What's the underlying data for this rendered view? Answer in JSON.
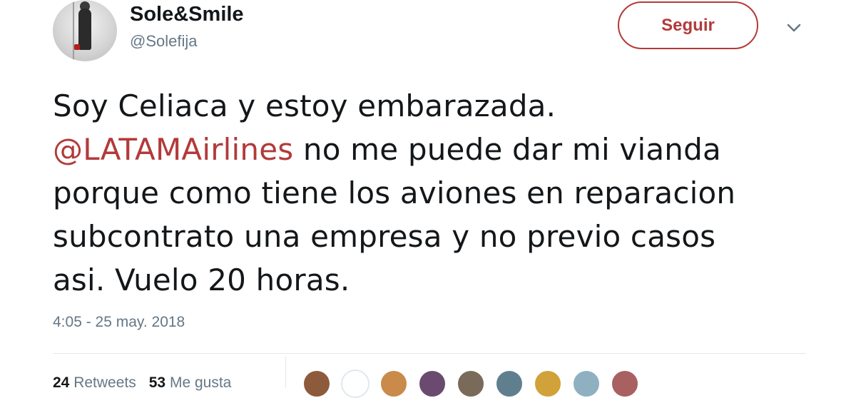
{
  "user": {
    "display_name": "Sole&Smile",
    "handle": "@Solefija",
    "avatar_icon": "profile-photo-icon"
  },
  "follow_button": {
    "label": "Seguir"
  },
  "menu_caret": {
    "icon": "chevron-down-icon"
  },
  "tweet": {
    "line1": "Soy Celiaca y estoy embarazada.",
    "mention": "@LATAMAirlines",
    "line2_rest": " no me puede dar mi vianda",
    "line3": "porque como tiene los aviones en reparacion",
    "line4": "subcontrato una empresa y no previo casos",
    "line5": "asi. Vuelo 20 horas."
  },
  "timestamp": "4:05 - 25 may. 2018",
  "stats": {
    "retweets_count": "24",
    "retweets_label": "Retweets",
    "likes_count": "53",
    "likes_label": "Me gusta"
  },
  "likers": [
    {
      "color": "#8d5a3b"
    },
    {
      "color": "#ffffff"
    },
    {
      "color": "#c98a4a"
    },
    {
      "color": "#6a4a6e"
    },
    {
      "color": "#7a6a5a"
    },
    {
      "color": "#5f7f8f"
    },
    {
      "color": "#d1a23a"
    },
    {
      "color": "#8fb0c0"
    },
    {
      "color": "#a86060"
    }
  ],
  "colors": {
    "accent": "#b33a3a",
    "secondary_text": "#657786"
  }
}
